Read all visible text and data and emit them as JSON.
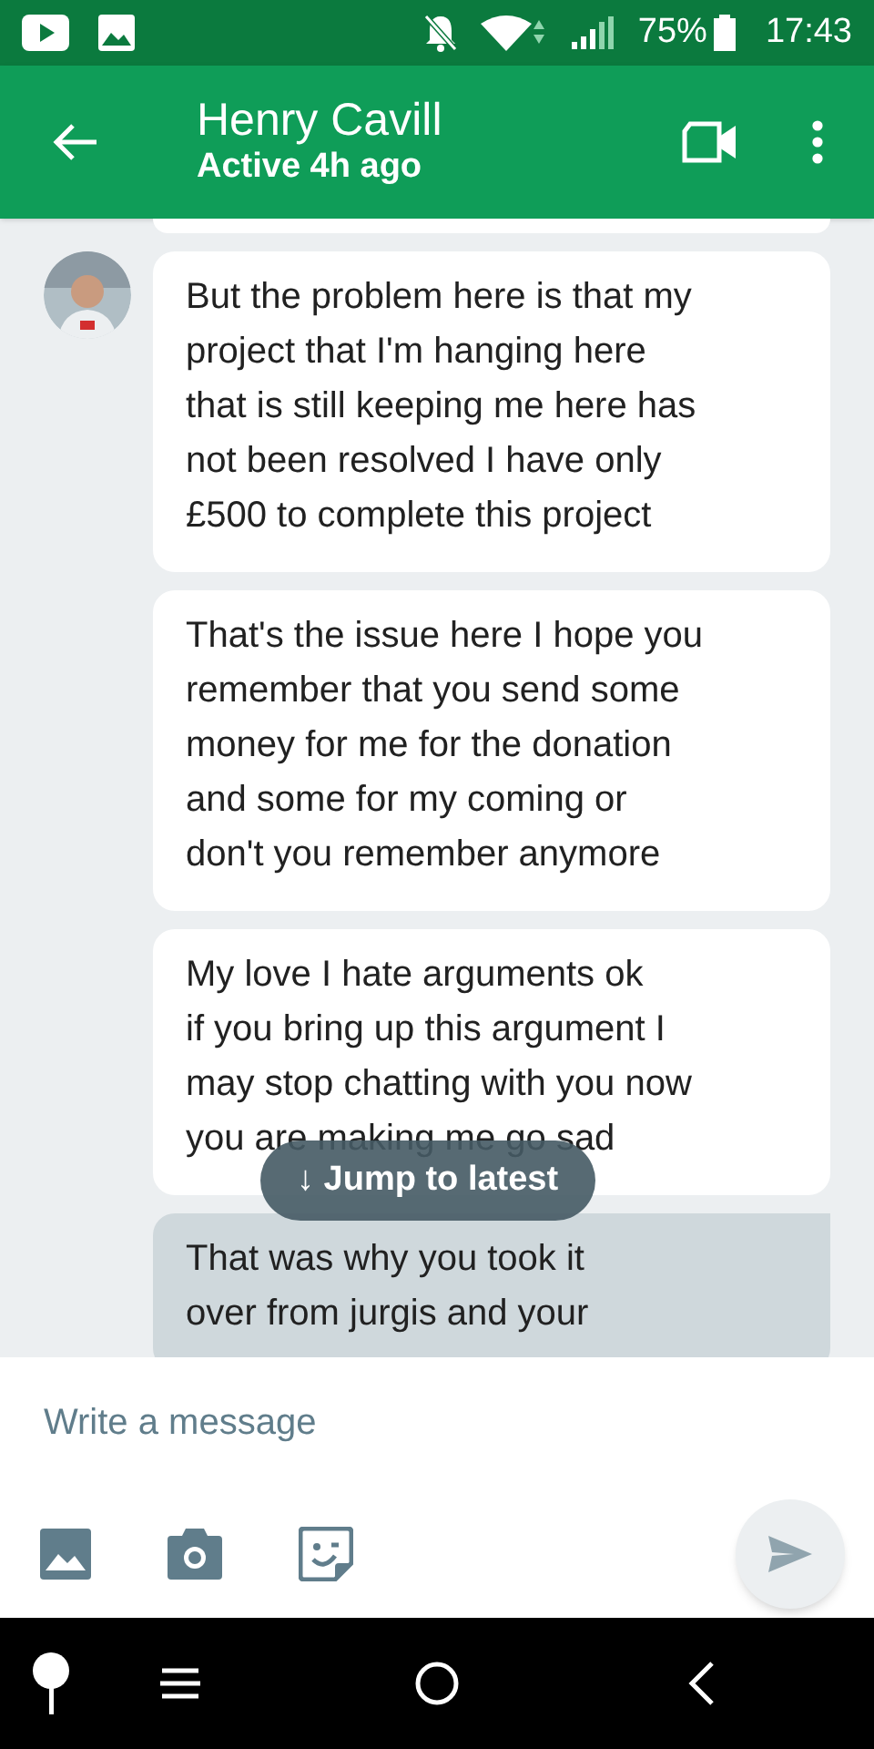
{
  "status_bar": {
    "battery": "75%",
    "time": "17:43"
  },
  "header": {
    "name": "Henry Cavill",
    "status": "Active 4h ago"
  },
  "messages": [
    {
      "kind": "incoming",
      "avatar": true,
      "text": "But the problem here is that my\nproject that I'm hanging here\nthat is still keeping me here has\nnot been resolved I have only\n£500 to complete this project"
    },
    {
      "kind": "incoming",
      "avatar": false,
      "text": "That's the issue here I hope you\nremember that you send some\nmoney for me for the donation\nand some for my coming or\ndon't you remember anymore"
    },
    {
      "kind": "incoming",
      "avatar": false,
      "text": "My love I hate arguments ok\nif you bring up this argument I\nmay stop chatting with you now\nyou are making me go sad"
    },
    {
      "kind": "outgoing",
      "avatar": false,
      "text": "That was why you took it\nover from jurgis and your"
    }
  ],
  "jump_button": {
    "label": "↓ Jump to latest"
  },
  "composer": {
    "placeholder": "Write a message"
  }
}
